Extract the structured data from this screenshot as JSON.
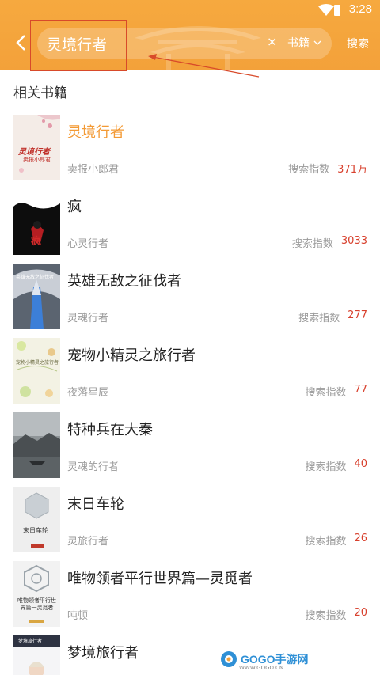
{
  "status_bar": {
    "time": "3:28"
  },
  "search": {
    "query": "灵境行者",
    "clear": "×",
    "scope": "书籍",
    "submit": "搜索"
  },
  "section_title": "相关书籍",
  "index_label": "搜索指数",
  "books": [
    {
      "title": "灵境行者",
      "author": "卖报小郎君",
      "index": "371万",
      "cover_text": "灵境行者",
      "cover_sub": "卖报小郎君"
    },
    {
      "title": "疯",
      "author": "心灵行者",
      "index": "3033",
      "cover_text": "疯"
    },
    {
      "title": "英雄无敌之征伐者",
      "author": "灵魂行者",
      "index": "277",
      "cover_text": "英雄无敌之征伐者"
    },
    {
      "title": "宠物小精灵之旅行者",
      "author": "夜落星辰",
      "index": "77",
      "cover_text": "宠物小精灵之旅行者"
    },
    {
      "title": "特种兵在大秦",
      "author": "灵魂的行者",
      "index": "40"
    },
    {
      "title": "末日车轮",
      "author": "灵旅行者",
      "index": "26",
      "cover_text": "末日车轮"
    },
    {
      "title": "唯物领者平行世界篇—灵觅者",
      "author": "吨顿",
      "index": "20",
      "cover_text": "唯物领者平行世界篇一灵觅者"
    },
    {
      "title": "梦境旅行者",
      "author": "",
      "index": "",
      "cover_text": "梦境旅行者"
    }
  ],
  "watermark": {
    "brand": "GOGO手游网",
    "url": "WWW.GOGO.CN"
  }
}
